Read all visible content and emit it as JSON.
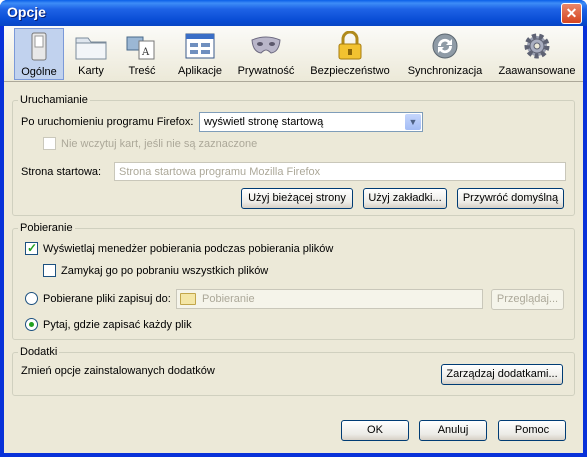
{
  "window": {
    "title": "Opcje",
    "close_glyph": "✕"
  },
  "toolbar": {
    "tabs": [
      {
        "label": "Ogólne",
        "icon": "switch-icon"
      },
      {
        "label": "Karty",
        "icon": "tabs-icon"
      },
      {
        "label": "Treść",
        "icon": "content-icon"
      },
      {
        "label": "Aplikacje",
        "icon": "applications-icon"
      },
      {
        "label": "Prywatność",
        "icon": "mask-icon"
      },
      {
        "label": "Bezpieczeństwo",
        "icon": "padlock-icon"
      },
      {
        "label": "Synchronizacja",
        "icon": "sync-icon"
      },
      {
        "label": "Zaawansowane",
        "icon": "gear-icon"
      }
    ],
    "selected": "Ogólne"
  },
  "startup": {
    "group_title": "Uruchamianie",
    "on_start_label": "Po uruchomieniu programu Firefox:",
    "on_start_value": "wyświetl stronę startową",
    "dont_load_tabs_label": "Nie wczytuj kart, jeśli nie są zaznaczone",
    "dont_load_tabs_checked": false,
    "homepage_label": "Strona startowa:",
    "homepage_placeholder": "Strona startowa programu Mozilla Firefox",
    "use_current_label": "Użyj bieżącej strony",
    "use_bookmark_label": "Użyj zakładki...",
    "restore_default_label": "Przywróć domyślną"
  },
  "downloads": {
    "group_title": "Pobieranie",
    "show_manager_label": "Wyświetlaj menedżer pobierania podczas pobierania plików",
    "show_manager_checked": true,
    "close_when_done_label": "Zamykaj go po pobraniu wszystkich plików",
    "close_when_done_checked": false,
    "save_to_label": "Pobierane pliki zapisuj do:",
    "save_to_folder": "Pobieranie",
    "browse_label": "Przeglądaj...",
    "ask_label": "Pytaj, gdzie zapisać każdy plik",
    "selected_option": "ask"
  },
  "addons": {
    "group_title": "Dodatki",
    "description": "Zmień opcje zainstalowanych dodatków",
    "manage_label": "Zarządzaj dodatkami..."
  },
  "footer": {
    "ok_label": "OK",
    "cancel_label": "Anuluj",
    "help_label": "Pomoc"
  },
  "colors": {
    "titlebar": "#0a4ed6",
    "window_bg": "#ece9d8",
    "selected_tab": "#c1d2ee",
    "check_mark": "#21a121"
  }
}
